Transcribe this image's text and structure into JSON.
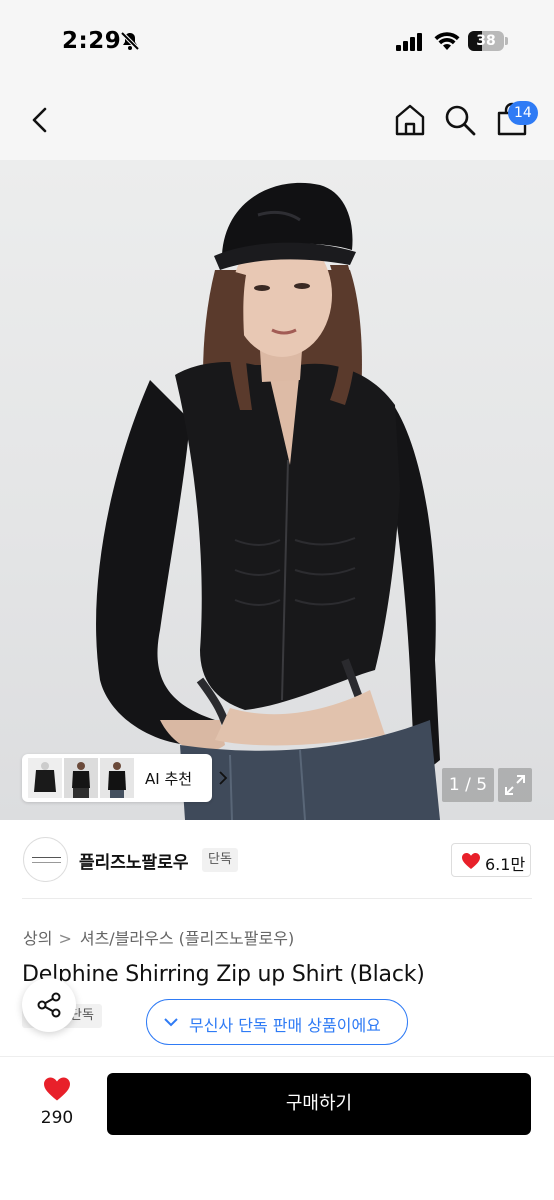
{
  "status_bar": {
    "time": "2:29",
    "battery_level": "38",
    "battery_fraction": 0.38,
    "icons": [
      "bell-slash-icon",
      "cellular-signal-icon",
      "wifi-icon",
      "battery-icon"
    ]
  },
  "nav": {
    "icons": [
      "chevron-left-icon",
      "home-icon",
      "search-icon",
      "shopping-bag-icon"
    ],
    "cart_badge": "14",
    "accent_color": "#2f7bf5"
  },
  "gallery": {
    "ai_recommend_label": "AI 추천",
    "page_counter": "1 / 5",
    "icons": [
      "expand-icon"
    ]
  },
  "brand": {
    "name": "플리즈노팔로우",
    "badge": "단독",
    "like_count": "6.1만",
    "heart_color": "#e8202a"
  },
  "product": {
    "breadcrumb": [
      "상의",
      "셔츠/블라우스 (플리즈노팔로우)"
    ],
    "title": "Delphine Shirring Zip up Shirt (Black)",
    "exclusive_tag": "단독",
    "exclusive_notice": "무신사 단독 판매 상품이에요"
  },
  "bottom_bar": {
    "like_count": "290",
    "buy_label": "구매하기"
  }
}
